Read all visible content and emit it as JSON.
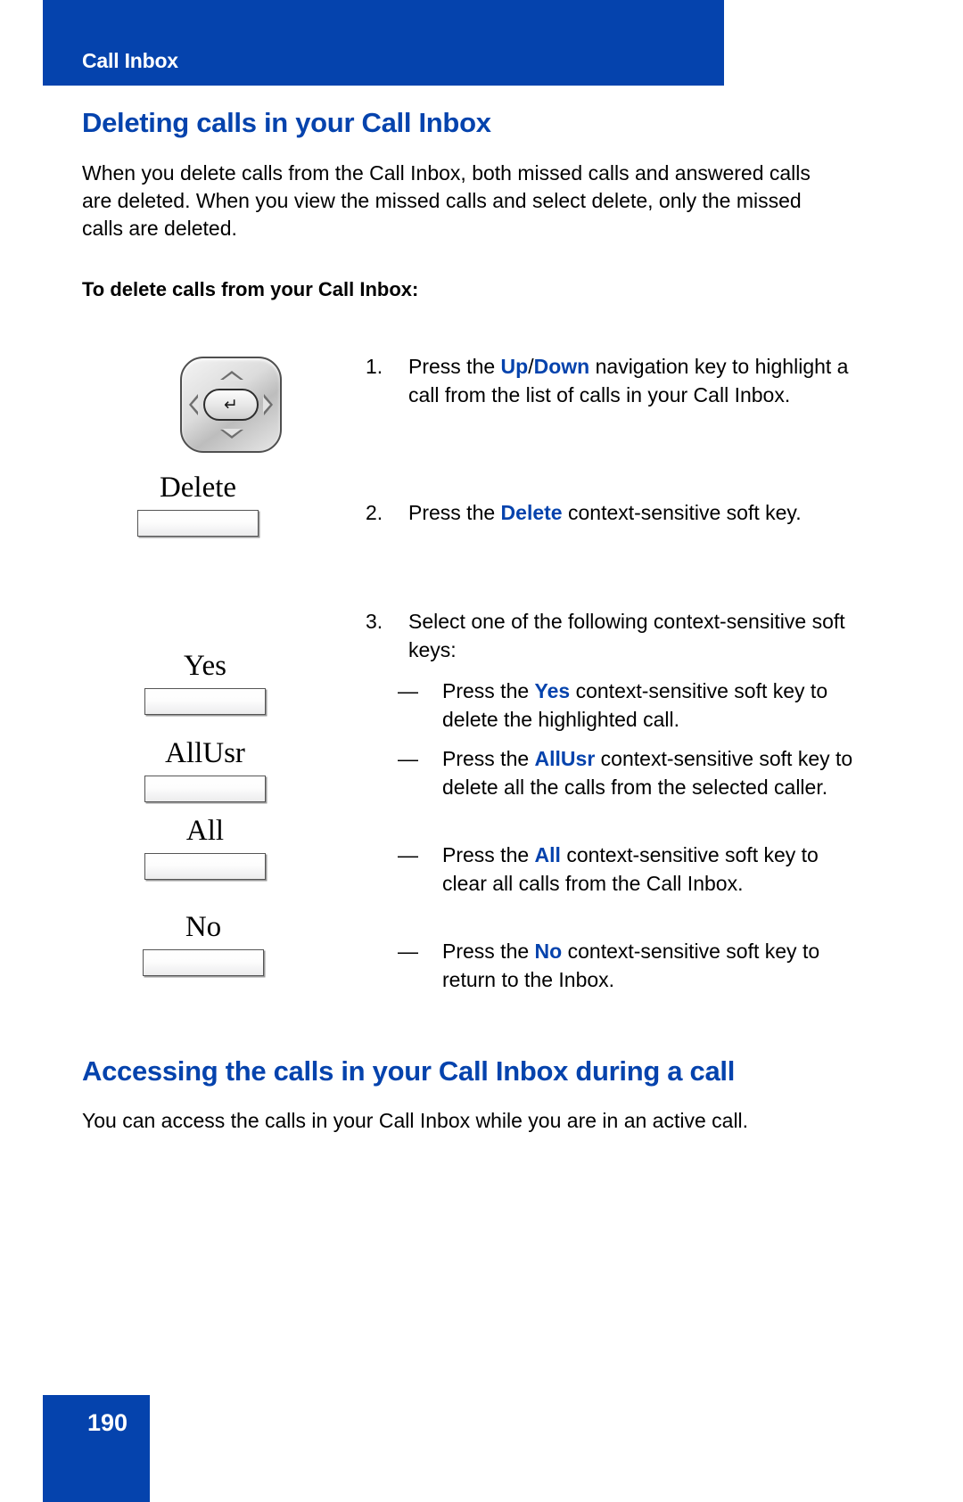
{
  "colors": {
    "brand_blue": "#0543ad",
    "text_black": "#000000",
    "page_white": "#ffffff"
  },
  "header": {
    "running_title": "Call Inbox"
  },
  "main": {
    "section_title": "Deleting calls in your Call Inbox",
    "intro_paragraph": "When you delete calls from the Call Inbox, both missed calls and answered calls are deleted. When you view the missed calls and select delete, only the missed calls are deleted.",
    "sub_heading": "To delete calls from your Call Inbox:"
  },
  "figures": {
    "nav_key": {
      "icon": "navigation-cluster-icon",
      "up_icon": "chevron-up-icon",
      "down_icon": "chevron-down-icon",
      "left_icon": "chevron-left-icon",
      "right_icon": "chevron-right-icon",
      "center_icon": "enter-key-icon",
      "center_glyph": "↵"
    },
    "soft_keys": [
      {
        "label": "Delete"
      },
      {
        "label": "Yes"
      },
      {
        "label": "AllUsr"
      },
      {
        "label": "All"
      },
      {
        "label": "No"
      }
    ]
  },
  "steps": [
    {
      "number": "1.",
      "pre": "Press the ",
      "kw1": "Up",
      "sep": "/",
      "kw2": "Down",
      "post": " navigation key to highlight a call from the list of calls in your Call Inbox."
    },
    {
      "number": "2.",
      "pre": "Press the ",
      "kw1": "Delete",
      "post": " context-sensitive soft key."
    },
    {
      "number": "3.",
      "pre": "Select one of the following context-sensitive soft keys:"
    }
  ],
  "sub_items": [
    {
      "dash": "—",
      "pre": "Press the ",
      "kw": "Yes",
      "post": " context-sensitive soft key to delete the highlighted call."
    },
    {
      "dash": "—",
      "pre": "Press the ",
      "kw": "AllUsr",
      "post": " context-sensitive soft key to delete all the calls from the selected caller."
    },
    {
      "dash": "—",
      "pre": "Press the ",
      "kw": "All",
      "post": " context-sensitive soft key to clear all calls from the Call Inbox."
    },
    {
      "dash": "—",
      "pre": "Press the ",
      "kw": "No",
      "post": " context-sensitive soft key to return to the Inbox."
    }
  ],
  "bottom": {
    "section_title": "Accessing the calls in your Call Inbox during a call",
    "paragraph": "You can access the calls in your Call Inbox while you are in an active call."
  },
  "footer": {
    "page_number": "190"
  }
}
